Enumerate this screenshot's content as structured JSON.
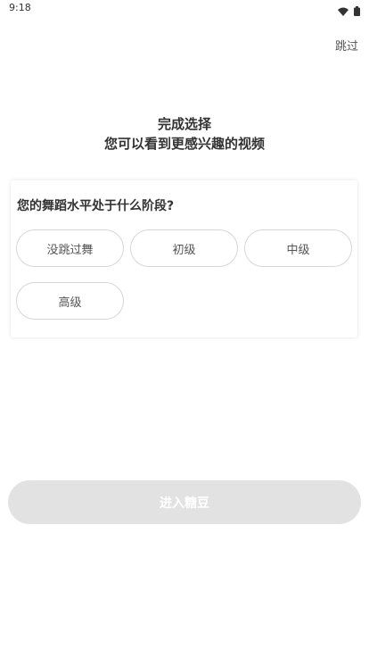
{
  "status_bar": {
    "time": "9:18",
    "icons": [
      "wifi-icon",
      "battery-icon"
    ]
  },
  "header": {
    "skip_label": "跳过"
  },
  "intro": {
    "line1": "完成选择",
    "line2": "您可以看到更感兴趣的视频"
  },
  "question": {
    "text": "您的舞蹈水平处于什么阶段?",
    "options": [
      "没跳过舞",
      "初级",
      "中级",
      "高级"
    ]
  },
  "footer": {
    "enter_label": "进入糖豆"
  },
  "colors": {
    "button_disabled": "#e2e2e2",
    "option_border": "#d6d6d6",
    "text_primary": "#333333"
  }
}
